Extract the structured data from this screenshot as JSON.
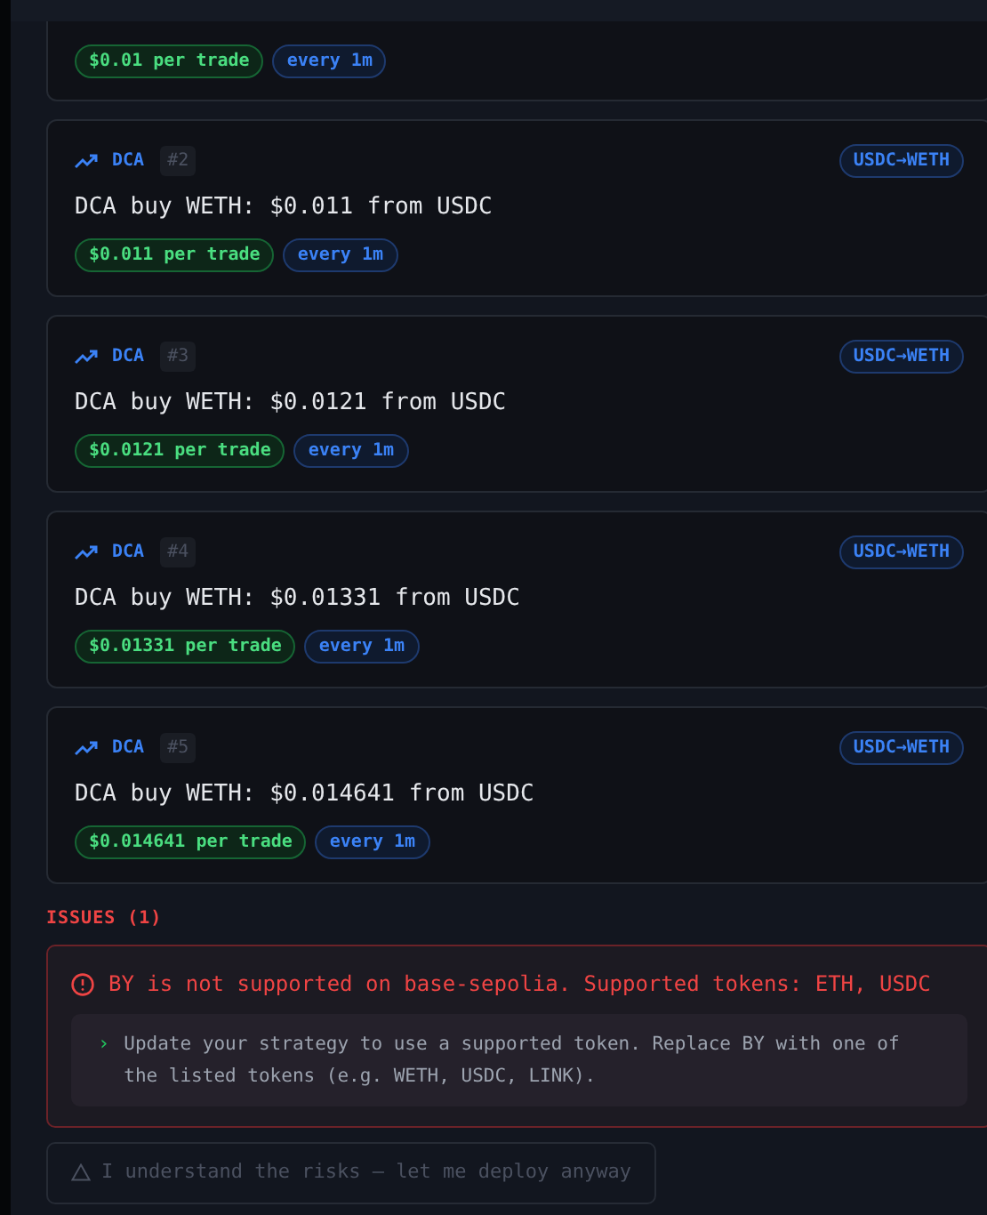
{
  "strategies": [
    {
      "amount": "$0.01 per trade",
      "interval": "every 1m"
    },
    {
      "type": "DCA",
      "index": "#2",
      "pair": "USDC→WETH",
      "description": "DCA buy WETH: $0.011 from USDC",
      "amount": "$0.011 per trade",
      "interval": "every 1m"
    },
    {
      "type": "DCA",
      "index": "#3",
      "pair": "USDC→WETH",
      "description": "DCA buy WETH: $0.0121 from USDC",
      "amount": "$0.0121 per trade",
      "interval": "every 1m"
    },
    {
      "type": "DCA",
      "index": "#4",
      "pair": "USDC→WETH",
      "description": "DCA buy WETH: $0.01331 from USDC",
      "amount": "$0.01331 per trade",
      "interval": "every 1m"
    },
    {
      "type": "DCA",
      "index": "#5",
      "pair": "USDC→WETH",
      "description": "DCA buy WETH: $0.014641 from USDC",
      "amount": "$0.014641 per trade",
      "interval": "every 1m"
    }
  ],
  "issues": {
    "heading": "ISSUES (1)",
    "items": [
      {
        "message": "BY is not supported on base-sepolia. Supported tokens: ETH, USDC",
        "suggestion_marker": "›",
        "suggestion": "Update your strategy to use a supported token. Replace BY with one of the listed tokens (e.g. WETH, USDC, LINK)."
      }
    ]
  },
  "override_button": {
    "label": "I understand the risks — let me deploy anyway",
    "disabled": true
  }
}
